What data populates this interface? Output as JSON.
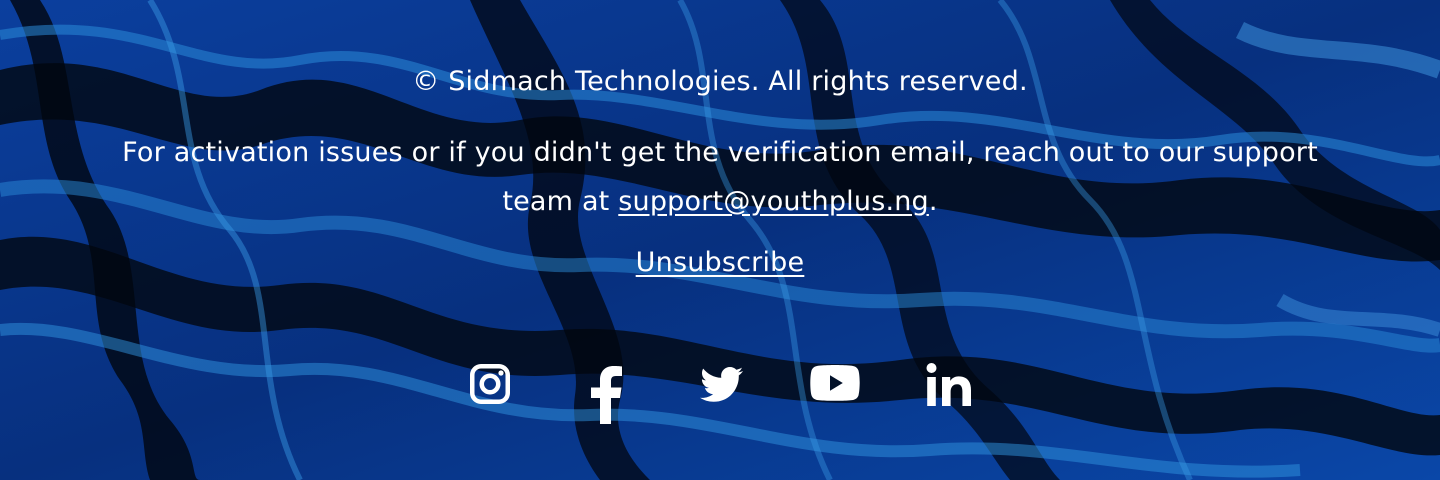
{
  "footer": {
    "copyright": "© Sidmach Technologies. All rights reserved.",
    "support_text_before": "For activation issues or if you didn't get the verification email, reach out to our support team at ",
    "support_email": "support@youthplus.ng",
    "support_text_after": ".",
    "unsubscribe_label": "Unsubscribe"
  },
  "social": [
    {
      "name": "instagram",
      "icon": "instagram-icon"
    },
    {
      "name": "facebook",
      "icon": "facebook-icon"
    },
    {
      "name": "twitter",
      "icon": "twitter-icon"
    },
    {
      "name": "youtube",
      "icon": "youtube-icon"
    },
    {
      "name": "linkedin",
      "icon": "linkedin-icon"
    }
  ],
  "colors": {
    "text": "#ffffff",
    "background_dark": "#03122a",
    "background_blue": "#0a3f9c",
    "background_light_blue": "#1b78c8"
  }
}
